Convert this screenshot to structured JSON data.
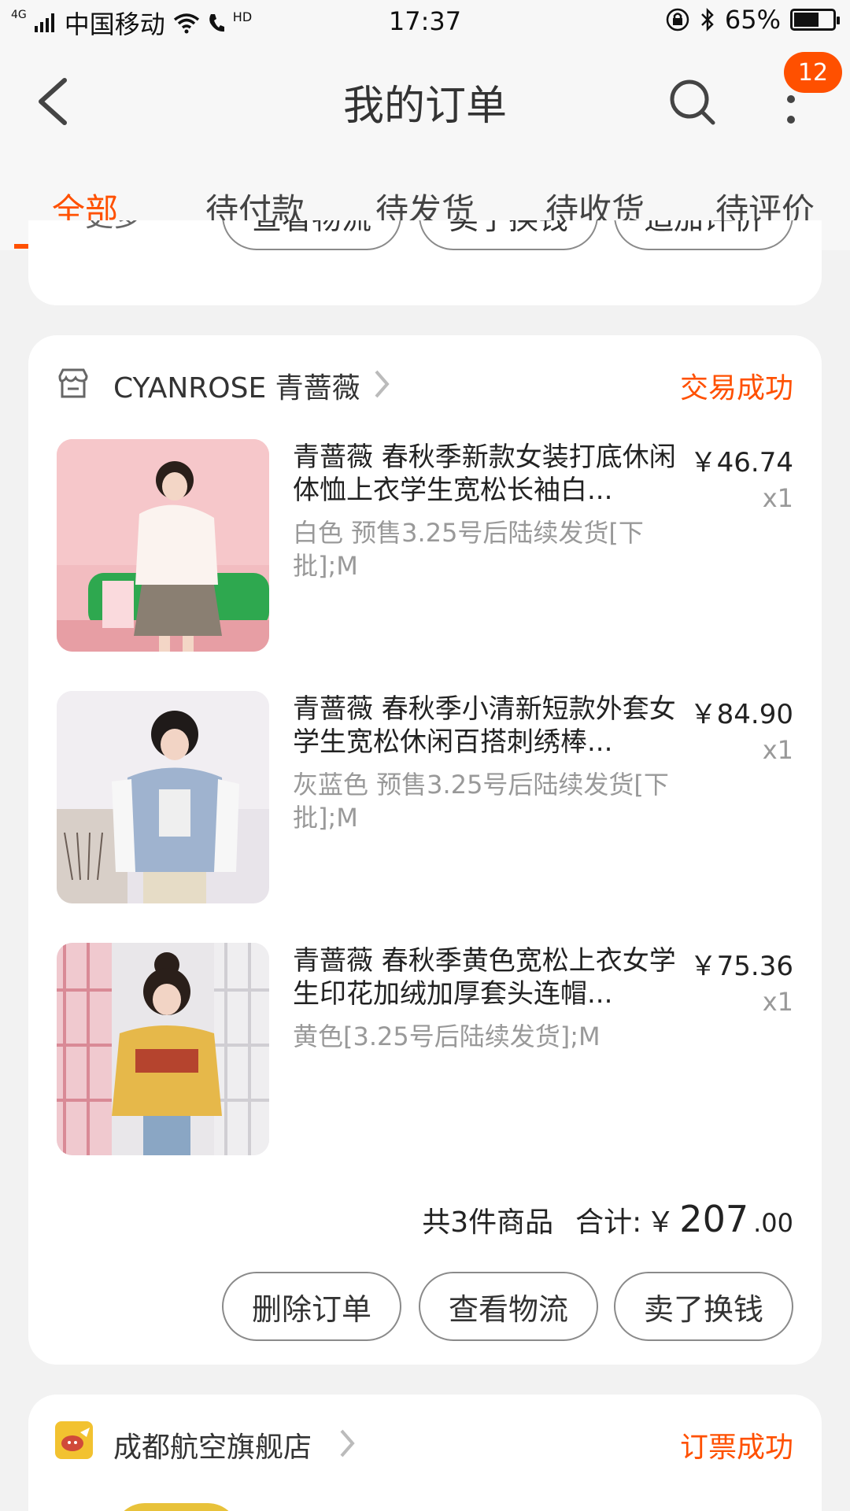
{
  "status_bar": {
    "network": "4G",
    "carrier": "中国移动",
    "hd": "HD",
    "time": "17:37",
    "battery": "65%",
    "battery_level": 0.65
  },
  "header": {
    "title": "我的订单",
    "badge_count": "12"
  },
  "tabs": [
    {
      "label": "全部",
      "active": true
    },
    {
      "label": "待付款"
    },
    {
      "label": "待发货"
    },
    {
      "label": "待收货"
    },
    {
      "label": "待评价"
    }
  ],
  "previous_order": {
    "left_label": "更多",
    "buttons": [
      "查看物流",
      "卖了换钱",
      "追加评价"
    ]
  },
  "order": {
    "store_name": "CYANROSE 青蔷薇",
    "status": "交易成功",
    "items": [
      {
        "title": "青蔷薇 春秋季新款女装打底休闲体恤上衣学生宽松长袖白...",
        "spec": "白色 预售3.25号后陆续发货[下批];M",
        "price": "￥46.74",
        "qty": "x1"
      },
      {
        "title": "青蔷薇 春秋季小清新短款外套女学生宽松休闲百搭刺绣棒...",
        "spec": "灰蓝色 预售3.25号后陆续发货[下批];M",
        "price": "￥84.90",
        "qty": "x1"
      },
      {
        "title": "青蔷薇 春秋季黄色宽松上衣女学生印花加绒加厚套头连帽...",
        "spec": "黄色[3.25号后陆续发货];M",
        "price": "￥75.36",
        "qty": "x1"
      }
    ],
    "summary_count": "共3件商品",
    "summary_label": "合计:",
    "currency": "￥",
    "total_int": "207",
    "total_dec": ".00",
    "buttons": [
      "删除订单",
      "查看物流",
      "卖了换钱"
    ]
  },
  "next_order": {
    "store_name": "成都航空旗舰店",
    "status": "订票成功"
  },
  "colors": {
    "accent": "#ff5000"
  }
}
